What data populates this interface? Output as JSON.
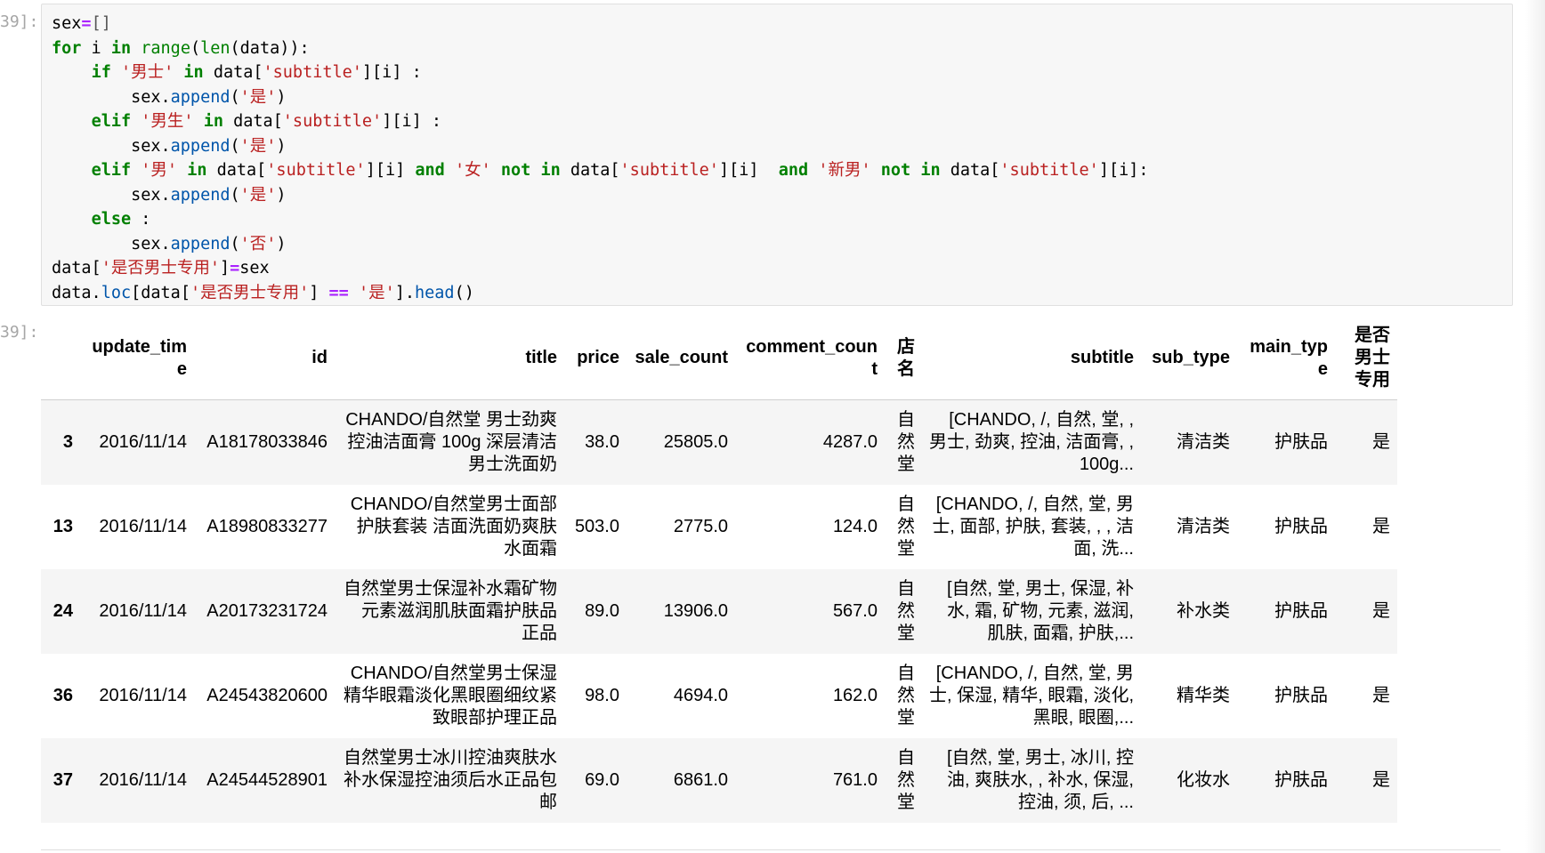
{
  "prompts": {
    "input": "39]:",
    "output": "39]:"
  },
  "code": [
    [
      {
        "t": "sex"
      },
      {
        "t": "=",
        "c": "op"
      },
      {
        "t": "[]",
        "c": "br"
      }
    ],
    [
      {
        "t": "for",
        "c": "kw"
      },
      {
        "t": " i "
      },
      {
        "t": "in",
        "c": "kw"
      },
      {
        "t": " "
      },
      {
        "t": "range",
        "c": "bi"
      },
      {
        "t": "("
      },
      {
        "t": "len",
        "c": "bi"
      },
      {
        "t": "(data)):"
      }
    ],
    [
      {
        "t": "    "
      },
      {
        "t": "if",
        "c": "kw"
      },
      {
        "t": " "
      },
      {
        "t": "'男士'",
        "c": "st"
      },
      {
        "t": " "
      },
      {
        "t": "in",
        "c": "kw"
      },
      {
        "t": " data["
      },
      {
        "t": "'subtitle'",
        "c": "st"
      },
      {
        "t": "][i] :"
      }
    ],
    [
      {
        "t": "        sex."
      },
      {
        "t": "append",
        "c": "fn"
      },
      {
        "t": "("
      },
      {
        "t": "'是'",
        "c": "st"
      },
      {
        "t": ")"
      }
    ],
    [
      {
        "t": "    "
      },
      {
        "t": "elif",
        "c": "kw"
      },
      {
        "t": " "
      },
      {
        "t": "'男生'",
        "c": "st"
      },
      {
        "t": " "
      },
      {
        "t": "in",
        "c": "kw"
      },
      {
        "t": " data["
      },
      {
        "t": "'subtitle'",
        "c": "st"
      },
      {
        "t": "][i] :"
      }
    ],
    [
      {
        "t": "        sex."
      },
      {
        "t": "append",
        "c": "fn"
      },
      {
        "t": "("
      },
      {
        "t": "'是'",
        "c": "st"
      },
      {
        "t": ")"
      }
    ],
    [
      {
        "t": "    "
      },
      {
        "t": "elif",
        "c": "kw"
      },
      {
        "t": " "
      },
      {
        "t": "'男'",
        "c": "st"
      },
      {
        "t": " "
      },
      {
        "t": "in",
        "c": "kw"
      },
      {
        "t": " data["
      },
      {
        "t": "'subtitle'",
        "c": "st"
      },
      {
        "t": "][i] "
      },
      {
        "t": "and",
        "c": "kw"
      },
      {
        "t": " "
      },
      {
        "t": "'女'",
        "c": "st"
      },
      {
        "t": " "
      },
      {
        "t": "not",
        "c": "kw"
      },
      {
        "t": " "
      },
      {
        "t": "in",
        "c": "kw"
      },
      {
        "t": " data["
      },
      {
        "t": "'subtitle'",
        "c": "st"
      },
      {
        "t": "][i]  "
      },
      {
        "t": "and",
        "c": "kw"
      },
      {
        "t": " "
      },
      {
        "t": "'新男'",
        "c": "st"
      },
      {
        "t": " "
      },
      {
        "t": "not",
        "c": "kw"
      },
      {
        "t": " "
      },
      {
        "t": "in",
        "c": "kw"
      },
      {
        "t": " data["
      },
      {
        "t": "'subtitle'",
        "c": "st"
      },
      {
        "t": "][i]:"
      }
    ],
    [
      {
        "t": "        sex."
      },
      {
        "t": "append",
        "c": "fn"
      },
      {
        "t": "("
      },
      {
        "t": "'是'",
        "c": "st"
      },
      {
        "t": ")"
      }
    ],
    [
      {
        "t": "    "
      },
      {
        "t": "else",
        "c": "kw"
      },
      {
        "t": " :"
      }
    ],
    [
      {
        "t": "        sex."
      },
      {
        "t": "append",
        "c": "fn"
      },
      {
        "t": "("
      },
      {
        "t": "'否'",
        "c": "st"
      },
      {
        "t": ")"
      }
    ],
    [
      {
        "t": "data["
      },
      {
        "t": "'是否男士专用'",
        "c": "st"
      },
      {
        "t": "]"
      },
      {
        "t": "=",
        "c": "op"
      },
      {
        "t": "sex"
      }
    ],
    [
      {
        "t": "data."
      },
      {
        "t": "loc",
        "c": "fn"
      },
      {
        "t": "[data["
      },
      {
        "t": "'是否男士专用'",
        "c": "st"
      },
      {
        "t": "] "
      },
      {
        "t": "==",
        "c": "op"
      },
      {
        "t": " "
      },
      {
        "t": "'是'",
        "c": "st"
      },
      {
        "t": "]."
      },
      {
        "t": "head",
        "c": "fn"
      },
      {
        "t": "()"
      }
    ]
  ],
  "table": {
    "columns": [
      "",
      "update_time",
      "id",
      "title",
      "price",
      "sale_count",
      "comment_count",
      "店名",
      "subtitle",
      "sub_type",
      "main_type",
      "是否男士专用"
    ],
    "rows": [
      [
        "3",
        "2016/11/14",
        "A18178033846",
        "CHANDO/自然堂 男士劲爽控油洁面膏 100g 深层清洁 男士洗面奶",
        "38.0",
        "25805.0",
        "4287.0",
        "自然堂",
        "[CHANDO, /, 自然, 堂, , 男士, 劲爽, 控油, 洁面膏, , 100g...",
        "清洁类",
        "护肤品",
        "是"
      ],
      [
        "13",
        "2016/11/14",
        "A18980833277",
        "CHANDO/自然堂男士面部护肤套装 洁面洗面奶爽肤水面霜",
        "503.0",
        "2775.0",
        "124.0",
        "自然堂",
        "[CHANDO, /, 自然, 堂, 男士, 面部, 护肤, 套装, , , 洁面, 洗...",
        "清洁类",
        "护肤品",
        "是"
      ],
      [
        "24",
        "2016/11/14",
        "A20173231724",
        "自然堂男士保湿补水霜矿物元素滋润肌肤面霜护肤品 正品",
        "89.0",
        "13906.0",
        "567.0",
        "自然堂",
        "[自然, 堂, 男士, 保湿, 补水, 霜, 矿物, 元素, 滋润, 肌肤, 面霜, 护肤,...",
        "补水类",
        "护肤品",
        "是"
      ],
      [
        "36",
        "2016/11/14",
        "A24543820600",
        "CHANDO/自然堂男士保湿精华眼霜淡化黑眼圈细纹紧致眼部护理正品",
        "98.0",
        "4694.0",
        "162.0",
        "自然堂",
        "[CHANDO, /, 自然, 堂, 男士, 保湿, 精华, 眼霜, 淡化, 黑眼, 眼圈,...",
        "精华类",
        "护肤品",
        "是"
      ],
      [
        "37",
        "2016/11/14",
        "A24544528901",
        "自然堂男士冰川控油爽肤水 补水保湿控油须后水正品包邮",
        "69.0",
        "6861.0",
        "761.0",
        "自然堂",
        "[自然, 堂, 男士, 冰川, 控油, 爽肤水, , 补水, 保湿, 控油, 须, 后, ...",
        "化妆水",
        "护肤品",
        "是"
      ]
    ]
  }
}
